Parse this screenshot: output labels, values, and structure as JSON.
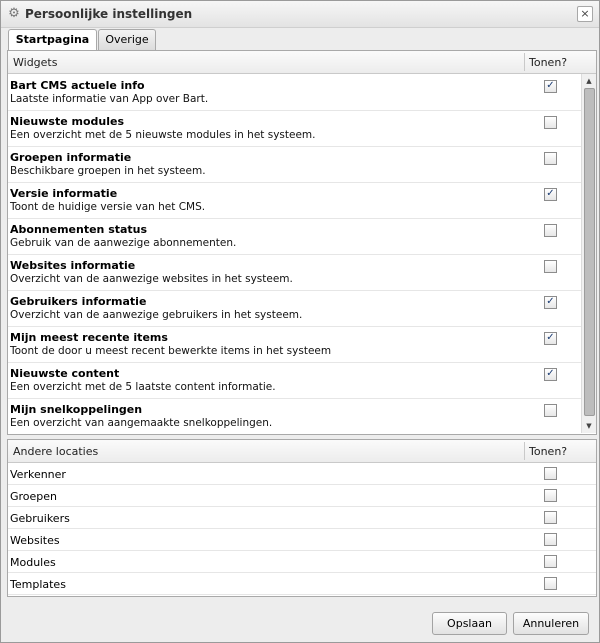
{
  "dialog": {
    "title": "Persoonlijke instellingen",
    "close_symbol": "×"
  },
  "tabs": [
    {
      "label": "Startpagina",
      "active": true
    },
    {
      "label": "Overige",
      "active": false
    }
  ],
  "widgets": {
    "header_name": "Widgets",
    "header_show": "Tonen?",
    "items": [
      {
        "name": "Bart CMS actuele info",
        "desc": "Laatste informatie van App over Bart.",
        "checked": true
      },
      {
        "name": "Nieuwste modules",
        "desc": "Een overzicht met de 5 nieuwste modules in het systeem.",
        "checked": false
      },
      {
        "name": "Groepen informatie",
        "desc": "Beschikbare groepen in het systeem.",
        "checked": false
      },
      {
        "name": "Versie informatie",
        "desc": "Toont de huidige versie van het CMS.",
        "checked": true
      },
      {
        "name": "Abonnementen status",
        "desc": "Gebruik van de aanwezige abonnementen.",
        "checked": false
      },
      {
        "name": "Websites informatie",
        "desc": "Overzicht van de aanwezige websites in het systeem.",
        "checked": false
      },
      {
        "name": "Gebruikers informatie",
        "desc": "Overzicht van de aanwezige gebruikers in het systeem.",
        "checked": true
      },
      {
        "name": "Mijn meest recente items",
        "desc": "Toont de door u meest recent bewerkte items in het systeem",
        "checked": true
      },
      {
        "name": "Nieuwste content",
        "desc": "Een overzicht met de 5 laatste content informatie.",
        "checked": true
      },
      {
        "name": "Mijn snelkoppelingen",
        "desc": "Een overzicht van aangemaakte snelkoppelingen.",
        "checked": false
      }
    ]
  },
  "locations": {
    "header_name": "Andere locaties",
    "header_show": "Tonen?",
    "items": [
      {
        "name": "Verkenner",
        "checked": false
      },
      {
        "name": "Groepen",
        "checked": false
      },
      {
        "name": "Gebruikers",
        "checked": false
      },
      {
        "name": "Websites",
        "checked": false
      },
      {
        "name": "Modules",
        "checked": false
      },
      {
        "name": "Templates",
        "checked": false
      }
    ]
  },
  "buttons": {
    "save": "Opslaan",
    "cancel": "Annuleren"
  },
  "icons": {
    "title": "gear-icon",
    "check": "✓"
  }
}
